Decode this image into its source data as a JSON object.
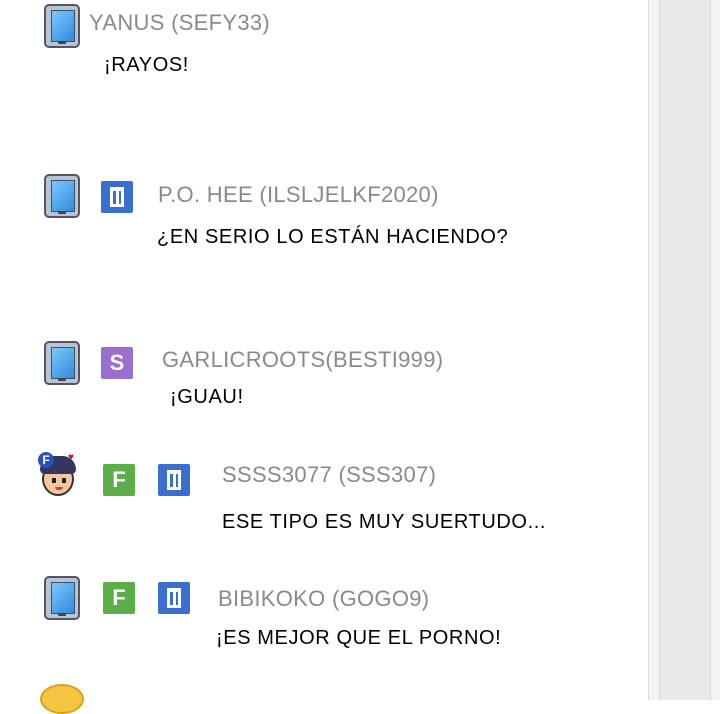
{
  "messages": [
    {
      "user": "YANUS (SEFY33)",
      "text": "¡RAYOS!",
      "badges": []
    },
    {
      "user": "P.O. HEE (ILSLJELKF2020)",
      "text": "¿EN SERIO LO ESTÁN HACIENDO?",
      "badges": [
        "blue"
      ]
    },
    {
      "user": "GARLICROOTS(BESTI999)",
      "text": "¡GUAU!",
      "badges": [
        "S"
      ]
    },
    {
      "user": "SSSS3077 (SSS307)",
      "text": "ESE TIPO ES MUY SUERTUDO...",
      "badges": [
        "F",
        "blue"
      ]
    },
    {
      "user": "BIBIKOKO (GOGO9)",
      "text": "¡ES MEJOR QUE EL PORNO!",
      "badges": [
        "F",
        "blue"
      ]
    }
  ],
  "icons": {
    "phone": "phone-icon",
    "character": "character-avatar-icon",
    "blue_badge": "blue-level-badge-icon"
  },
  "badge_letters": {
    "purple": "S",
    "green": "F",
    "avatar": "F"
  },
  "colors": {
    "username": "#8a8a8a",
    "message": "#000000",
    "badge_blue": "#3a6fd0",
    "badge_purple": "#9a6fd0",
    "badge_green": "#5cae48"
  }
}
